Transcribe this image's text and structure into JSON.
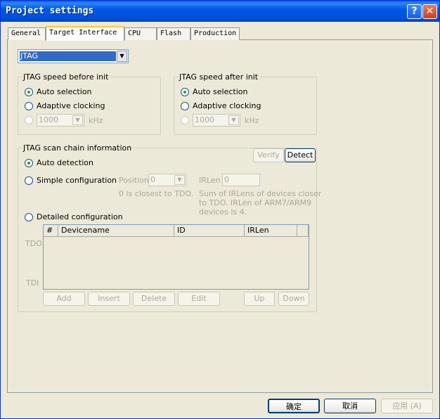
{
  "window": {
    "title": "Project settings"
  },
  "tabs": [
    "General",
    "Target Interface",
    "CPU",
    "Flash",
    "Production"
  ],
  "interface_select": {
    "value": "JTAG"
  },
  "speed_before": {
    "title": "JTAG speed before init",
    "auto": "Auto selection",
    "adaptive": "Adaptive clocking",
    "value": "1000",
    "unit": "kHz"
  },
  "speed_after": {
    "title": "JTAG speed after init",
    "auto": "Auto selection",
    "adaptive": "Adaptive clocking",
    "value": "1000",
    "unit": "kHz"
  },
  "scan_chain": {
    "title": "JTAG scan chain information",
    "verify": "Verify",
    "detect": "Detect",
    "auto_detection": "Auto detection",
    "simple": "Simple configuration",
    "position_label": "Position",
    "position_value": "0",
    "position_note": "0 is closest to TDO.",
    "irlen_label": "IRLen",
    "irlen_value": "0",
    "irlen_note_1": "Sum of IRLens of devices closer",
    "irlen_note_2": "to TDO. IRLen of ARM7/ARM9",
    "irlen_note_3": "devices is 4.",
    "detailed": "Detailed configuration",
    "tdo": "TDO",
    "tdi": "TDI",
    "columns": [
      "#",
      "Devicename",
      "ID",
      "IRLen"
    ],
    "buttons": {
      "add": "Add",
      "insert": "Insert",
      "delete": "Delete",
      "edit": "Edit",
      "up": "Up",
      "down": "Down"
    }
  },
  "footer": {
    "ok": "确定",
    "cancel": "取消",
    "apply": "应用 (A)"
  },
  "icons": {
    "help": "help-icon",
    "close": "close-icon",
    "dropdown": "chevron-down-icon"
  },
  "colors": {
    "titlebar": "#0058E6",
    "selection": "#316AC5",
    "dialog_bg": "#ECE9D8"
  }
}
